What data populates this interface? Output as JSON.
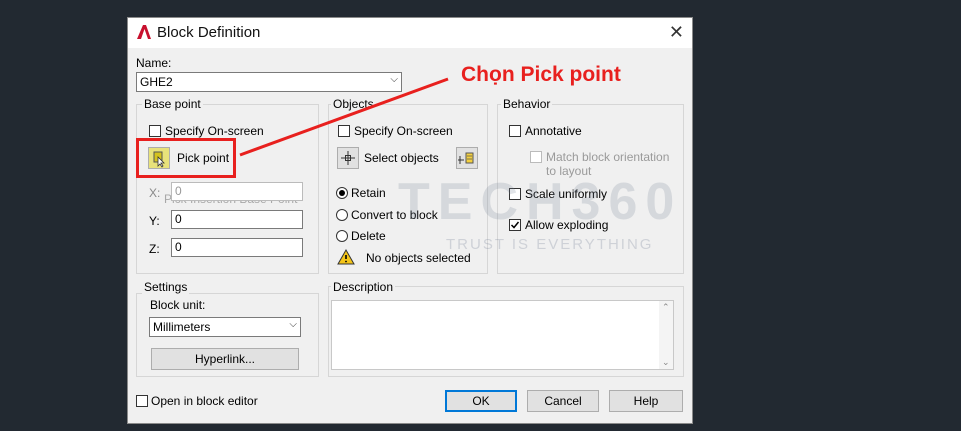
{
  "dialog": {
    "title": "Block Definition",
    "name_label": "Name:",
    "name_value": "GHE2",
    "base_point": {
      "group_label": "Base point",
      "specify_label": "Specify On-screen",
      "pick_label": "Pick point",
      "tooltip": "Pick Insertion Base Point",
      "x_label": "X:",
      "x_value": "0",
      "y_label": "Y:",
      "y_value": "0",
      "z_label": "Z:",
      "z_value": "0"
    },
    "objects": {
      "group_label": "Objects",
      "specify_label": "Specify On-screen",
      "select_label": "Select objects",
      "retain_label": "Retain",
      "convert_label": "Convert to block",
      "delete_label": "Delete",
      "status": "No objects selected"
    },
    "behavior": {
      "group_label": "Behavior",
      "annotative_label": "Annotative",
      "match_line1": "Match block orientation",
      "match_line2": "to layout",
      "scale_label": "Scale uniformly",
      "explode_label": "Allow exploding"
    },
    "settings": {
      "group_label": "Settings",
      "unit_label": "Block unit:",
      "unit_value": "Millimeters",
      "hyperlink_label": "Hyperlink..."
    },
    "description": {
      "group_label": "Description"
    },
    "open_editor_label": "Open in block editor",
    "ok_label": "OK",
    "cancel_label": "Cancel",
    "help_label": "Help"
  },
  "annotation": {
    "text": "Chọn Pick point",
    "color": "#e8201e"
  },
  "watermark": {
    "brand": "TECH360",
    "tagline": "TRUST IS EVERYTHING"
  },
  "colors": {
    "highlight": "#e8201e",
    "accent": "#0078d7",
    "background": "#222931"
  }
}
